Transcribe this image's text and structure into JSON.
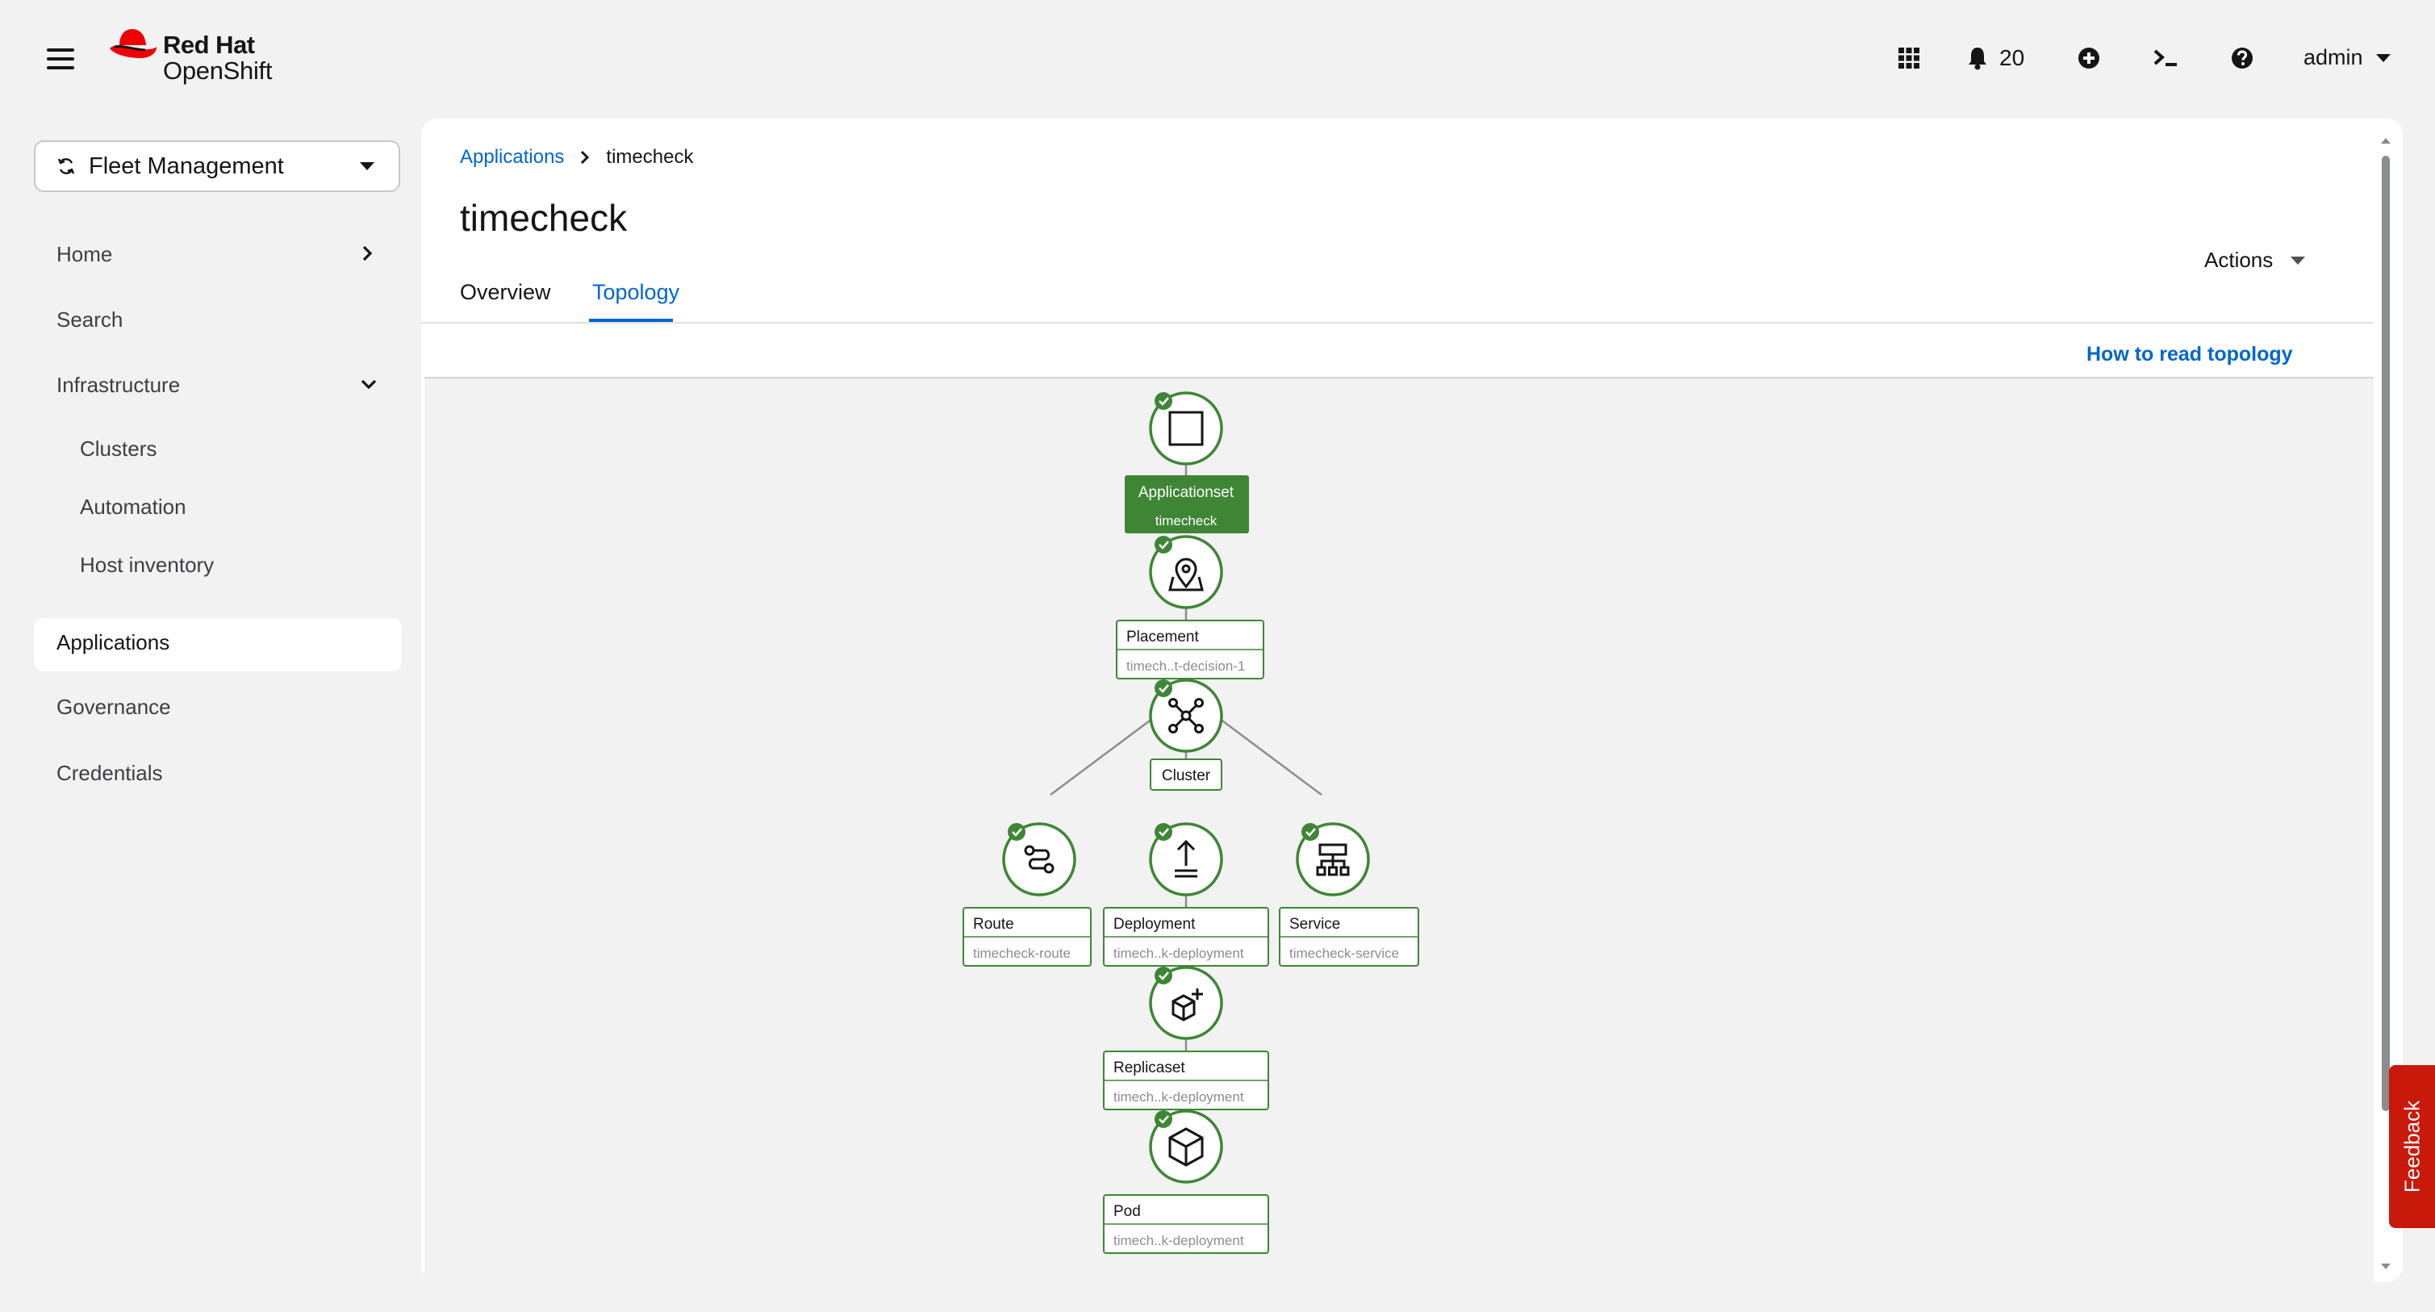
{
  "brand": {
    "line1": "Red Hat",
    "line2": "OpenShift"
  },
  "topbar": {
    "notifications_count": "20",
    "user": "admin"
  },
  "perspective": {
    "name": "Fleet Management"
  },
  "nav": {
    "home": "Home",
    "search": "Search",
    "infrastructure": "Infrastructure",
    "clusters": "Clusters",
    "automation": "Automation",
    "host_inventory": "Host inventory",
    "applications": "Applications",
    "governance": "Governance",
    "credentials": "Credentials"
  },
  "breadcrumb": {
    "parent": "Applications",
    "current": "timecheck"
  },
  "page": {
    "title": "timecheck",
    "actions_label": "Actions"
  },
  "tabs": {
    "overview": "Overview",
    "topology": "Topology"
  },
  "topology": {
    "help_link": "How to read topology",
    "nodes": {
      "applicationset": {
        "label": "Applicationset",
        "sub": "timecheck"
      },
      "placement": {
        "label": "Placement",
        "sub": "timech..t-decision-1"
      },
      "cluster": {
        "label": "Cluster"
      },
      "route": {
        "label": "Route",
        "sub": "timecheck-route"
      },
      "deployment": {
        "label": "Deployment",
        "sub": "timech..k-deployment"
      },
      "service": {
        "label": "Service",
        "sub": "timecheck-service"
      },
      "replicaset": {
        "label": "Replicaset",
        "sub": "timech..k-deployment"
      },
      "pod": {
        "label": "Pod",
        "sub": "timech..k-deployment"
      }
    }
  },
  "feedback": {
    "label": "Feedback"
  },
  "colors": {
    "accent": "#0066cc",
    "node_green": "#3e8635",
    "status_green": "#3e8635",
    "feedback_red": "#c9190b"
  }
}
